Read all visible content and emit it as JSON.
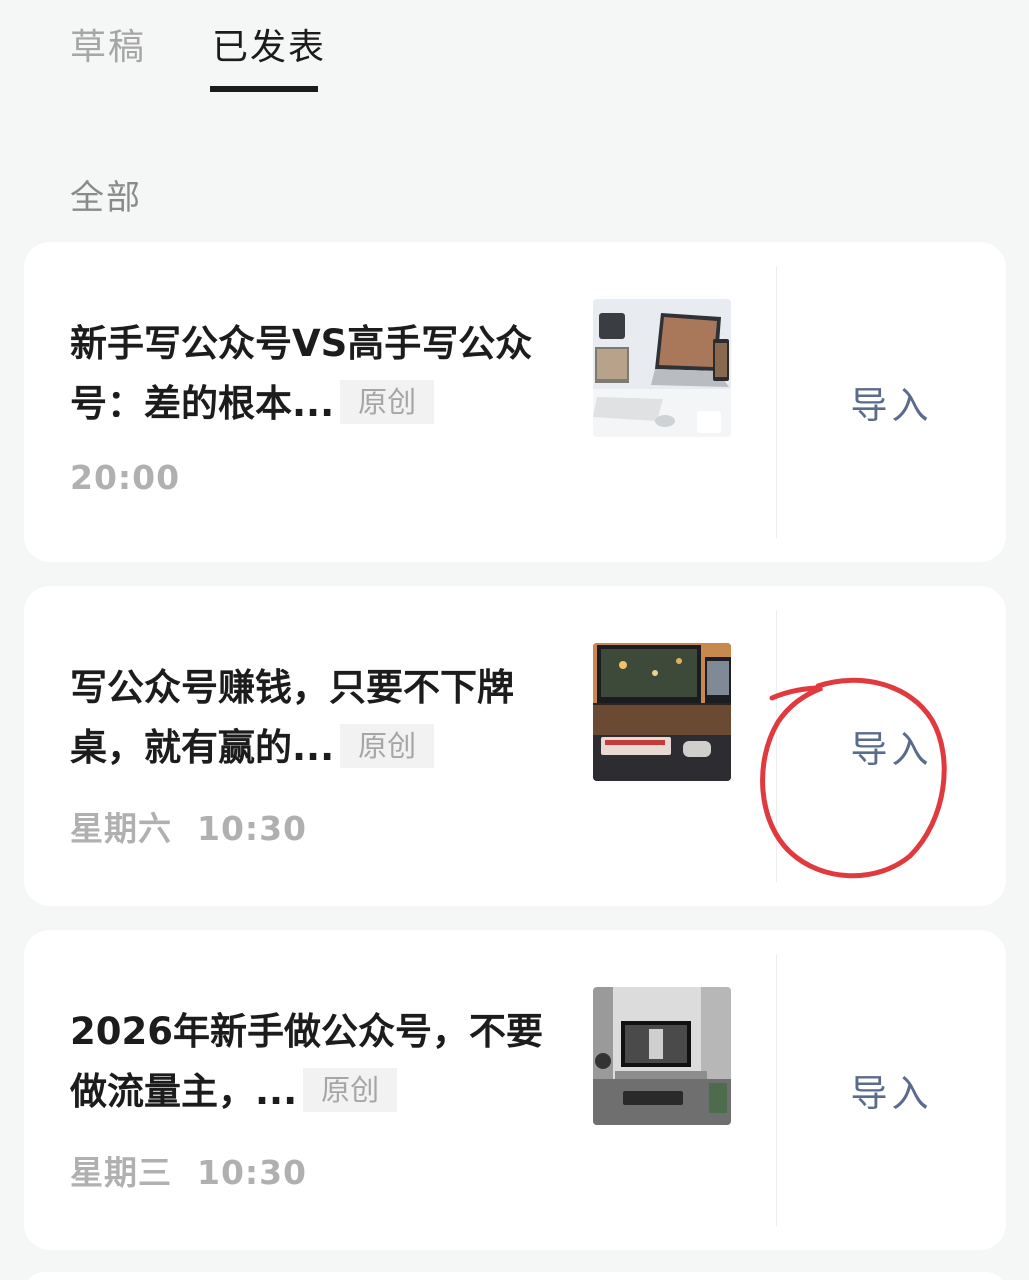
{
  "tabs": [
    {
      "label": "草稿",
      "active": false
    },
    {
      "label": "已发表",
      "active": true
    }
  ],
  "filter": {
    "label": "全部"
  },
  "articles": [
    {
      "title": "新手写公众号VS高手写公众号：差的根本...",
      "badge": "原创",
      "time": "20:00",
      "action": "导入",
      "thumbnail": "desk-setup-laptop-image"
    },
    {
      "title": "写公众号赚钱，只要不下牌桌，就有赢的...",
      "badge": "原创",
      "time": "星期六  10:30",
      "action": "导入",
      "thumbnail": "night-desk-setup-image"
    },
    {
      "title": "2026年新手做公众号，不要做流量主，...",
      "badge": "原创",
      "time": "星期三  10:30",
      "action": "导入",
      "thumbnail": "monochrome-desk-setup-image"
    }
  ],
  "colors": {
    "background": "#f5f6f6",
    "card": "#ffffff",
    "title": "#1c1c1c",
    "muted": "#b0b0b0",
    "import_link": "#5b6b8c",
    "annotation": "#e0393e"
  }
}
